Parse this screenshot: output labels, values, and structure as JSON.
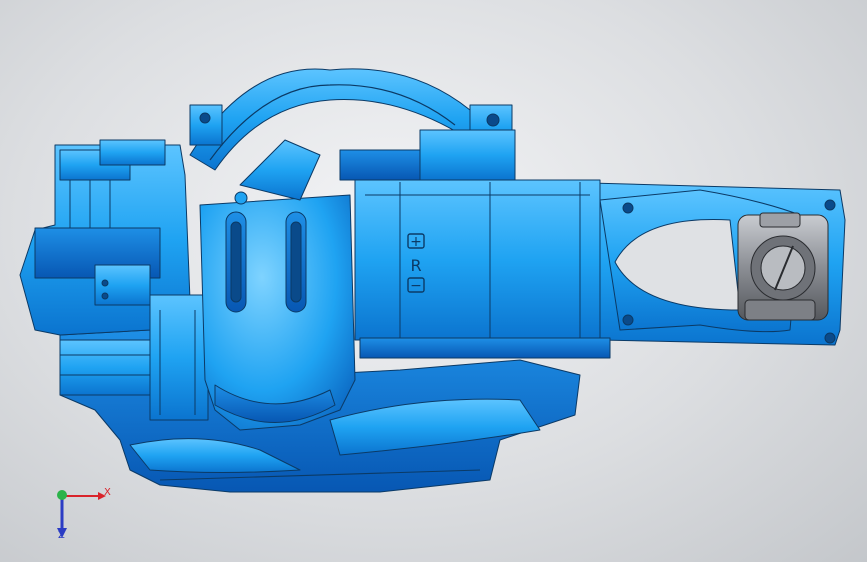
{
  "viewport": {
    "background_top": "#f3f4f6",
    "background_bottom": "#c4c7cb"
  },
  "model": {
    "body_color": "#1fa3f2",
    "shadow_color": "#0a6fc8",
    "highlight_color": "#63c9ff",
    "edge_color": "#0b3a66",
    "wrist_color": "#8b8e94",
    "markings": {
      "plus": "+",
      "letter": "R",
      "minus": "−"
    }
  },
  "triad": {
    "x_label": "X",
    "z_label": "Z",
    "x_color": "#d9232a",
    "y_color": "#2bb34a",
    "z_color": "#2b3cc4"
  }
}
